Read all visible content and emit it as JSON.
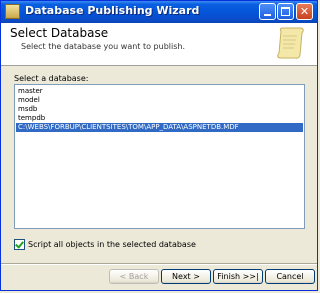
{
  "window": {
    "title": "Database Publishing Wizard",
    "title_bar_color": "#0a5fe0",
    "icons": {
      "app": "wizard-icon",
      "minimize": "minimize-icon",
      "maximize": "maximize-icon",
      "close": "close-icon"
    }
  },
  "header": {
    "title": "Select Database",
    "subtitle": "Select the database you want to publish.",
    "graphic": "scroll-icon"
  },
  "database_list": {
    "label": "Select a database:",
    "items": [
      "master",
      "model",
      "msdb",
      "tempdb",
      "C:\\WEBS\\FORBUP\\CLIENTSITES\\TOM\\APP_DATA\\ASPNETDB.MDF"
    ],
    "selected_index": 4,
    "selection_color": "#316ac5"
  },
  "script_all": {
    "label": "Script all objects in the selected database",
    "checked": true
  },
  "buttons": {
    "back": "< Back",
    "next": "Next >",
    "finish": "Finish >>|",
    "cancel": "Cancel"
  }
}
